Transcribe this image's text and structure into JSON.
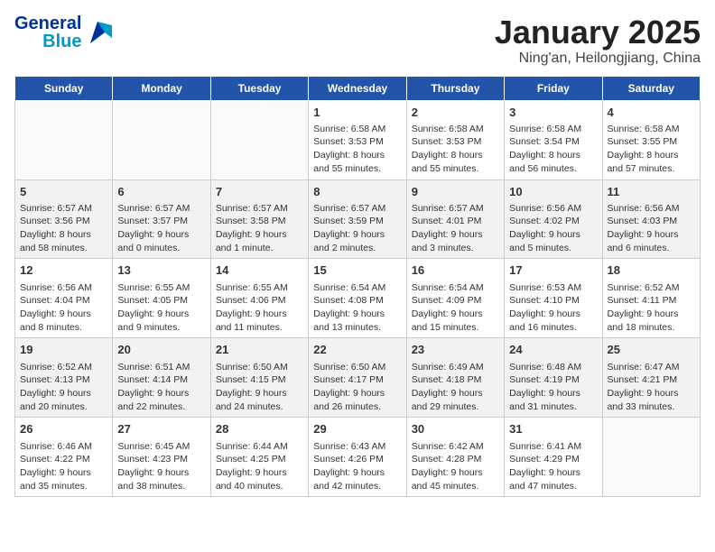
{
  "logo": {
    "general": "General",
    "blue": "Blue"
  },
  "title": "January 2025",
  "location": "Ning'an, Heilongjiang, China",
  "days": [
    "Sunday",
    "Monday",
    "Tuesday",
    "Wednesday",
    "Thursday",
    "Friday",
    "Saturday"
  ],
  "weeks": [
    [
      {
        "day": "",
        "content": ""
      },
      {
        "day": "",
        "content": ""
      },
      {
        "day": "",
        "content": ""
      },
      {
        "day": "1",
        "content": "Sunrise: 6:58 AM\nSunset: 3:53 PM\nDaylight: 8 hours\nand 55 minutes."
      },
      {
        "day": "2",
        "content": "Sunrise: 6:58 AM\nSunset: 3:53 PM\nDaylight: 8 hours\nand 55 minutes."
      },
      {
        "day": "3",
        "content": "Sunrise: 6:58 AM\nSunset: 3:54 PM\nDaylight: 8 hours\nand 56 minutes."
      },
      {
        "day": "4",
        "content": "Sunrise: 6:58 AM\nSunset: 3:55 PM\nDaylight: 8 hours\nand 57 minutes."
      }
    ],
    [
      {
        "day": "5",
        "content": "Sunrise: 6:57 AM\nSunset: 3:56 PM\nDaylight: 8 hours\nand 58 minutes."
      },
      {
        "day": "6",
        "content": "Sunrise: 6:57 AM\nSunset: 3:57 PM\nDaylight: 9 hours\nand 0 minutes."
      },
      {
        "day": "7",
        "content": "Sunrise: 6:57 AM\nSunset: 3:58 PM\nDaylight: 9 hours\nand 1 minute."
      },
      {
        "day": "8",
        "content": "Sunrise: 6:57 AM\nSunset: 3:59 PM\nDaylight: 9 hours\nand 2 minutes."
      },
      {
        "day": "9",
        "content": "Sunrise: 6:57 AM\nSunset: 4:01 PM\nDaylight: 9 hours\nand 3 minutes."
      },
      {
        "day": "10",
        "content": "Sunrise: 6:56 AM\nSunset: 4:02 PM\nDaylight: 9 hours\nand 5 minutes."
      },
      {
        "day": "11",
        "content": "Sunrise: 6:56 AM\nSunset: 4:03 PM\nDaylight: 9 hours\nand 6 minutes."
      }
    ],
    [
      {
        "day": "12",
        "content": "Sunrise: 6:56 AM\nSunset: 4:04 PM\nDaylight: 9 hours\nand 8 minutes."
      },
      {
        "day": "13",
        "content": "Sunrise: 6:55 AM\nSunset: 4:05 PM\nDaylight: 9 hours\nand 9 minutes."
      },
      {
        "day": "14",
        "content": "Sunrise: 6:55 AM\nSunset: 4:06 PM\nDaylight: 9 hours\nand 11 minutes."
      },
      {
        "day": "15",
        "content": "Sunrise: 6:54 AM\nSunset: 4:08 PM\nDaylight: 9 hours\nand 13 minutes."
      },
      {
        "day": "16",
        "content": "Sunrise: 6:54 AM\nSunset: 4:09 PM\nDaylight: 9 hours\nand 15 minutes."
      },
      {
        "day": "17",
        "content": "Sunrise: 6:53 AM\nSunset: 4:10 PM\nDaylight: 9 hours\nand 16 minutes."
      },
      {
        "day": "18",
        "content": "Sunrise: 6:52 AM\nSunset: 4:11 PM\nDaylight: 9 hours\nand 18 minutes."
      }
    ],
    [
      {
        "day": "19",
        "content": "Sunrise: 6:52 AM\nSunset: 4:13 PM\nDaylight: 9 hours\nand 20 minutes."
      },
      {
        "day": "20",
        "content": "Sunrise: 6:51 AM\nSunset: 4:14 PM\nDaylight: 9 hours\nand 22 minutes."
      },
      {
        "day": "21",
        "content": "Sunrise: 6:50 AM\nSunset: 4:15 PM\nDaylight: 9 hours\nand 24 minutes."
      },
      {
        "day": "22",
        "content": "Sunrise: 6:50 AM\nSunset: 4:17 PM\nDaylight: 9 hours\nand 26 minutes."
      },
      {
        "day": "23",
        "content": "Sunrise: 6:49 AM\nSunset: 4:18 PM\nDaylight: 9 hours\nand 29 minutes."
      },
      {
        "day": "24",
        "content": "Sunrise: 6:48 AM\nSunset: 4:19 PM\nDaylight: 9 hours\nand 31 minutes."
      },
      {
        "day": "25",
        "content": "Sunrise: 6:47 AM\nSunset: 4:21 PM\nDaylight: 9 hours\nand 33 minutes."
      }
    ],
    [
      {
        "day": "26",
        "content": "Sunrise: 6:46 AM\nSunset: 4:22 PM\nDaylight: 9 hours\nand 35 minutes."
      },
      {
        "day": "27",
        "content": "Sunrise: 6:45 AM\nSunset: 4:23 PM\nDaylight: 9 hours\nand 38 minutes."
      },
      {
        "day": "28",
        "content": "Sunrise: 6:44 AM\nSunset: 4:25 PM\nDaylight: 9 hours\nand 40 minutes."
      },
      {
        "day": "29",
        "content": "Sunrise: 6:43 AM\nSunset: 4:26 PM\nDaylight: 9 hours\nand 42 minutes."
      },
      {
        "day": "30",
        "content": "Sunrise: 6:42 AM\nSunset: 4:28 PM\nDaylight: 9 hours\nand 45 minutes."
      },
      {
        "day": "31",
        "content": "Sunrise: 6:41 AM\nSunset: 4:29 PM\nDaylight: 9 hours\nand 47 minutes."
      },
      {
        "day": "",
        "content": ""
      }
    ]
  ]
}
